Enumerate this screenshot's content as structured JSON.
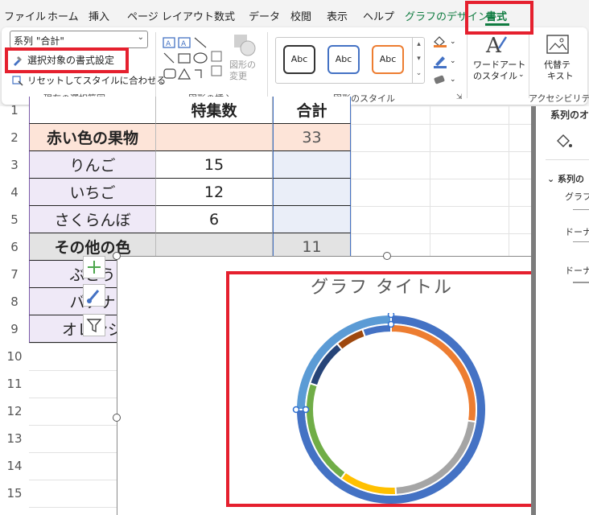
{
  "ribbon": {
    "tabs": [
      "ファイル",
      "ホーム",
      "挿入",
      "ページ レイアウト",
      "数式",
      "データ",
      "校閲",
      "表示",
      "ヘルプ",
      "グラフのデザイン",
      "書式"
    ],
    "active_tab": "書式",
    "current_selection": {
      "series_dropdown": "系列 \"合計\"",
      "format_selection": "選択対象の書式設定",
      "reset_to_match_style": "リセットしてスタイルに合わせる",
      "group_label": "現在の選択範囲"
    },
    "insert_shapes": {
      "change_shape_line1": "図形の",
      "change_shape_line2": "変更",
      "group_label": "図形の挿入"
    },
    "shape_styles": {
      "preset_label": "Abc",
      "preset_colors": [
        "#333333",
        "#4472c4",
        "#ed7d31"
      ],
      "group_label": "図形のスタイル"
    },
    "wordart_line1": "ワードアート",
    "wordart_line2": "のスタイル",
    "alt_text_line1": "代替テ",
    "alt_text_line2": "キスト",
    "accessibility_label": "アクセシビリティ"
  },
  "sheet": {
    "rows": [
      {
        "num": "1",
        "a": "",
        "b": "特集数",
        "c": "合計"
      },
      {
        "num": "2",
        "a": "赤い色の果物",
        "b": "",
        "c": "33",
        "kind": "header",
        "fill": "#fde4d8"
      },
      {
        "num": "3",
        "a": "りんご",
        "b": "15",
        "c": ""
      },
      {
        "num": "4",
        "a": "いちご",
        "b": "12",
        "c": ""
      },
      {
        "num": "5",
        "a": "さくらんぼ",
        "b": "6",
        "c": ""
      },
      {
        "num": "6",
        "a": "その他の色",
        "b": "",
        "c": "11",
        "kind": "header",
        "fill": "#e3e3e3"
      },
      {
        "num": "7",
        "a": "ぶどう",
        "b": "",
        "c": ""
      },
      {
        "num": "8",
        "a": "バナナ",
        "b": "",
        "c": ""
      },
      {
        "num": "9",
        "a": "オレンジ",
        "b": "",
        "c": ""
      },
      {
        "num": "10"
      },
      {
        "num": "11"
      },
      {
        "num": "12"
      },
      {
        "num": "13"
      },
      {
        "num": "14"
      },
      {
        "num": "15"
      },
      {
        "num": "16"
      }
    ]
  },
  "chart": {
    "title": "グラフ タイトル",
    "chart_data": {
      "type": "pie",
      "title": "グラフ タイトル",
      "inner_ring": {
        "values": [
          15,
          12,
          6,
          11,
          5,
          3,
          3
        ],
        "colors": [
          "#ed7d31",
          "#a5a5a5",
          "#ffc000",
          "#70ad47",
          "#264478",
          "#9e480e",
          "#4472c4"
        ]
      },
      "outer_ring": {
        "values": [
          33,
          11
        ],
        "colors": [
          "#4472c4",
          "#5b9bd5"
        ]
      }
    }
  },
  "pane": {
    "title": "系列のオ",
    "section": "系列の",
    "item1": "グラフの",
    "item2": "ドーナツ",
    "item3": "ドーナツ"
  }
}
